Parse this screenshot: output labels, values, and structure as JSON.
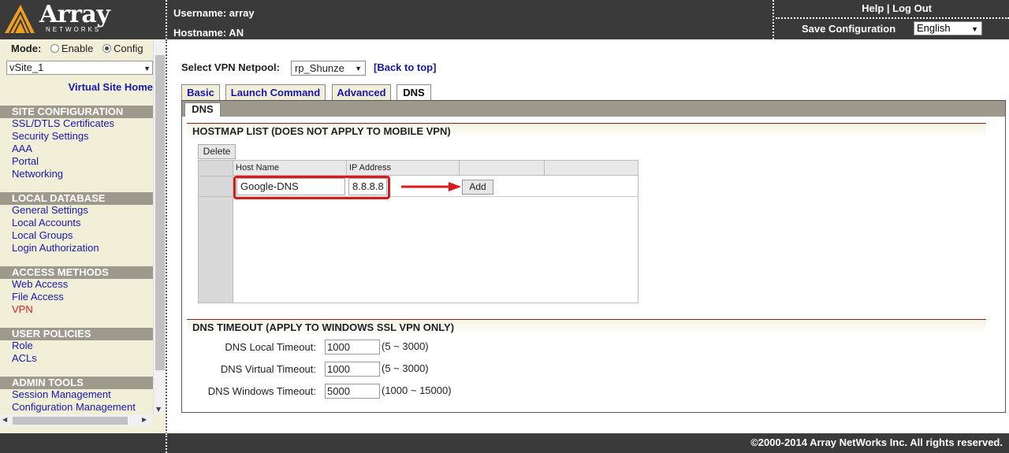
{
  "header": {
    "logo_brand": "Array",
    "logo_sub": "NETWORKS",
    "username_label": "Username: array",
    "hostname_label": "Hostname: AN",
    "help_label": "Help",
    "separator": " | ",
    "logout_label": "Log Out",
    "save_config_label": "Save Configuration",
    "language_value": "English"
  },
  "sidebar": {
    "mode_label": "Mode:",
    "mode_enable": "Enable",
    "mode_config": "Config",
    "mode_selected": "Config",
    "vsite_value": "vSite_1",
    "vsite_home": "Virtual Site Home",
    "sections": [
      {
        "title": "SITE CONFIGURATION",
        "items": [
          "SSL/DTLS Certificates",
          "Security Settings",
          "AAA",
          "Portal",
          "Networking"
        ]
      },
      {
        "title": "LOCAL DATABASE",
        "items": [
          "General Settings",
          "Local Accounts",
          "Local Groups",
          "Login Authorization"
        ]
      },
      {
        "title": "ACCESS METHODS",
        "items": [
          "Web Access",
          "File Access",
          "VPN"
        ]
      },
      {
        "title": "USER POLICIES",
        "items": [
          "Role",
          "ACLs"
        ]
      },
      {
        "title": "ADMIN TOOLS",
        "items": [
          "Session Management",
          "Configuration Management"
        ]
      }
    ],
    "active_item": "VPN"
  },
  "main": {
    "netpool_label": "Select VPN Netpool:",
    "netpool_value": "rp_Shunze",
    "back_to_top": "[Back to top]",
    "tabs": [
      {
        "label": "Basic"
      },
      {
        "label": "Launch Command"
      },
      {
        "label": "Advanced"
      },
      {
        "label": "DNS"
      }
    ],
    "active_tab": "DNS",
    "subtab": "DNS",
    "hostmap": {
      "title": "HOSTMAP LIST (DOES NOT APPLY TO MOBILE VPN)",
      "delete_label": "Delete",
      "columns": [
        "Host Name",
        "IP Address"
      ],
      "host_value": "Google-DNS",
      "ip_value": "8.8.8.8",
      "add_label": "Add"
    },
    "dns_timeout": {
      "title": "DNS TIMEOUT (APPLY TO WINDOWS SSL VPN ONLY)",
      "rows": [
        {
          "label": "DNS Local Timeout:",
          "value": "1000",
          "range": "(5 ~ 3000)"
        },
        {
          "label": "DNS Virtual Timeout:",
          "value": "1000",
          "range": "(5 ~ 3000)"
        },
        {
          "label": "DNS Windows Timeout:",
          "value": "5000",
          "range": "(1000 ~ 15000)"
        }
      ]
    }
  },
  "footer": {
    "copyright": "©2000-2014 Array NetWorks Inc. All rights reserved."
  },
  "colors": {
    "header_bg": "#3a3a3a",
    "sidebar_bg": "#f1efd7",
    "section_head_bg": "#9d9a8d",
    "link_blue": "#1818b0",
    "active_red": "#e02020",
    "highlight_red": "#d81a1a"
  }
}
